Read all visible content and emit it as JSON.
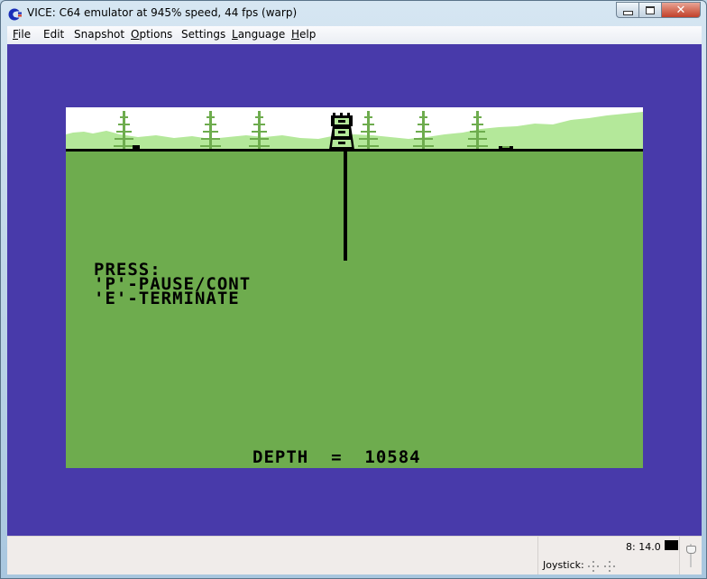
{
  "window": {
    "title": "VICE: C64 emulator at 945% speed, 44 fps (warp)",
    "controls": {
      "minimize": "minimize",
      "maximize": "maximize",
      "close": "close"
    }
  },
  "menubar": {
    "items": [
      {
        "label": "File",
        "mnemonic": "F",
        "rest": "ile"
      },
      {
        "label": "Edit",
        "mnemonic": "",
        "rest": "Edit"
      },
      {
        "label": "Snapshot",
        "mnemonic": "",
        "rest": "Snapshot"
      },
      {
        "label": "Options",
        "mnemonic": "O",
        "rest": "ptions"
      },
      {
        "label": "Settings",
        "mnemonic": "",
        "rest": "Settings"
      },
      {
        "label": "Language",
        "mnemonic": "L",
        "rest": "anguage"
      },
      {
        "label": "Help",
        "mnemonic": "H",
        "rest": "elp"
      }
    ]
  },
  "game": {
    "instructions": {
      "heading": "PRESS:",
      "line1": "'P'-PAUSE/CONT",
      "line2": "'E'-TERMINATE"
    },
    "depth_label": "DEPTH  =  ",
    "depth_value": "10584",
    "colors": {
      "border": "#483aaa",
      "ground": "#6eac4e",
      "sky": "#ffffff",
      "hills": "#b4e89a",
      "trees": "#6eac4e",
      "ink": "#000000"
    }
  },
  "statusbar": {
    "time": "8: 14.0",
    "joystick_label": "Joystick:",
    "drive_led_color": "#000000"
  }
}
